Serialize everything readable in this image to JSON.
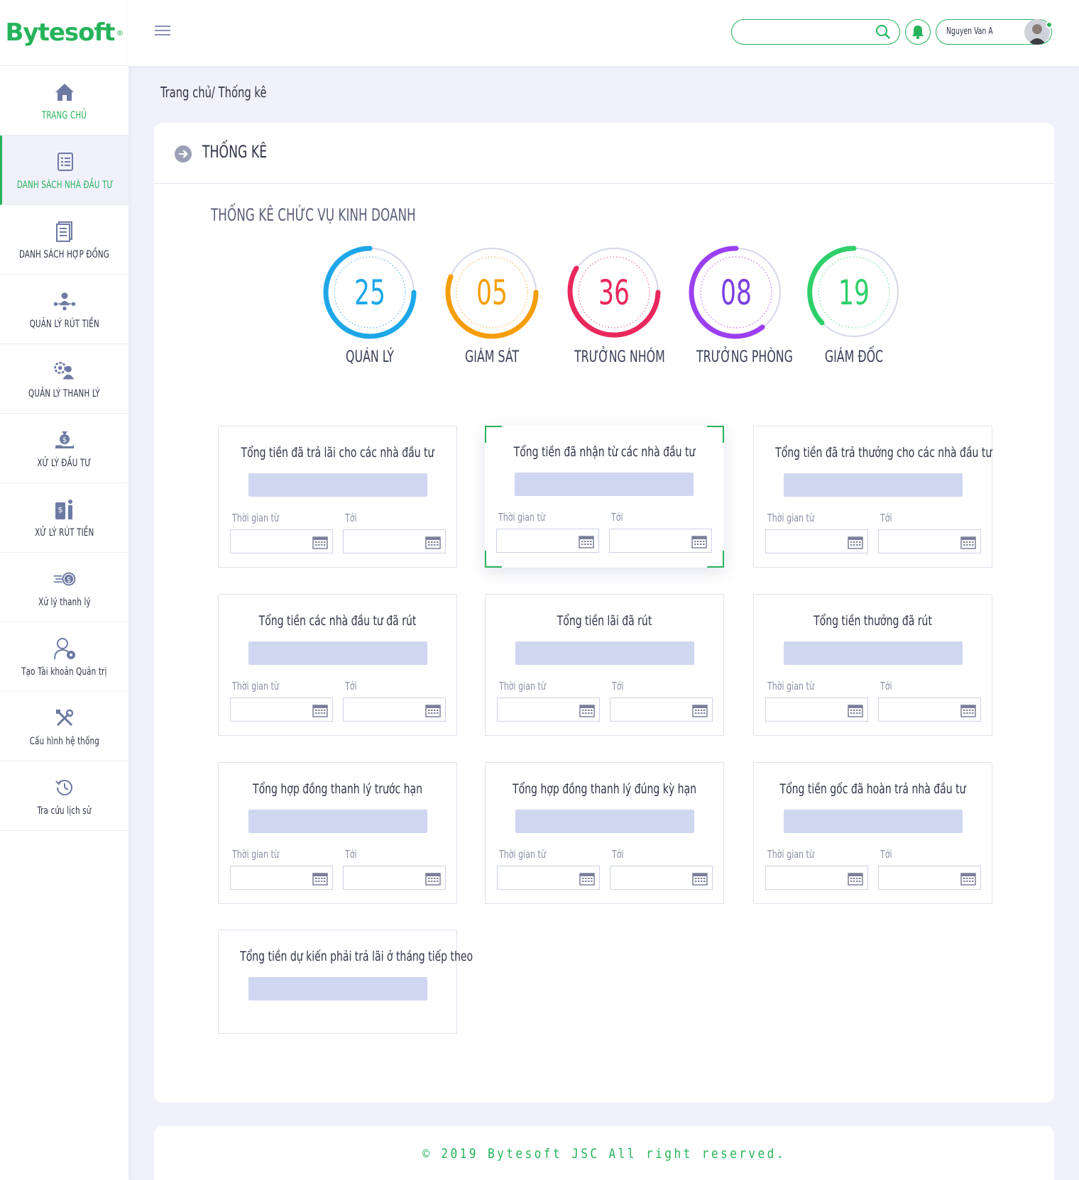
{
  "brand": {
    "name": "Bytesoft",
    "registered": "®"
  },
  "sidebar": {
    "items": [
      {
        "label": "TRANG CHỦ",
        "icon": "home-icon"
      },
      {
        "label": "DANH SÁCH NHÀ ĐẦU TƯ",
        "icon": "list-icon"
      },
      {
        "label": "DANH SÁCH HỢP ĐỒNG",
        "icon": "contract-icon"
      },
      {
        "label": "QUẢN LÝ RÚT TIỀN",
        "icon": "network-user-icon"
      },
      {
        "label": "QUẢN LÝ THANH LÝ",
        "icon": "user-gear-icon"
      },
      {
        "label": "XỬ LÝ ĐẦU TƯ",
        "icon": "money-bag-hand-icon"
      },
      {
        "label": "XỬ LÝ RÚT TIỀN",
        "icon": "withdraw-icon"
      },
      {
        "label": "Xử lý thanh lý",
        "icon": "fast-coin-icon"
      },
      {
        "label": "Tạo Tài khoản Quản trị",
        "icon": "admin-user-icon"
      },
      {
        "label": "Cấu hình hệ thống",
        "icon": "tools-icon"
      },
      {
        "label": "Tra cứu lịch sử",
        "icon": "history-icon"
      }
    ]
  },
  "header": {
    "search_placeholder": "",
    "user_name": "Nguyen Van A"
  },
  "breadcrumb": "Trang chủ/ Thống kê",
  "page": {
    "title": "THỐNG KÊ",
    "section_title": "THỐNG KÊ CHỨC VỤ KINH DOANH"
  },
  "positions": [
    {
      "value": "25",
      "label": "QUẢN LÝ",
      "color": "#1ea7e8"
    },
    {
      "value": "05",
      "label": "GIÁM SÁT",
      "color": "#f59e0b"
    },
    {
      "value": "36",
      "label": "TRƯỞNG NHÓM",
      "color": "#e8285c"
    },
    {
      "value": "08",
      "label": "TRƯỞNG PHÒNG",
      "color": "#9b3ff0"
    },
    {
      "value": "19",
      "label": "GIÁM ĐỐC",
      "color": "#2fd06a"
    }
  ],
  "stats": {
    "from_label": "Thời gian từ",
    "to_label": "Tới",
    "cards": [
      {
        "title": "Tổng tiền đã trả lãi cho các nhà đầu tư",
        "value": ""
      },
      {
        "title": "Tổng tiền đã nhận từ các nhà đầu tư",
        "value": ""
      },
      {
        "title": "Tổng tiền đã trả thưởng cho các nhà đầu tư",
        "value": ""
      },
      {
        "title": "Tổng tiền các nhà đầu tư đã rút",
        "value": ""
      },
      {
        "title": "Tổng tiền lãi đã rút",
        "value": ""
      },
      {
        "title": "Tổng tiền thưởng đã rút",
        "value": ""
      },
      {
        "title": "Tổng hợp đồng thanh lý trước hạn",
        "value": ""
      },
      {
        "title": "Tổng hợp đồng thanh lý đúng kỳ hạn",
        "value": ""
      },
      {
        "title": "Tổng tiền gốc đã hoàn trả nhà đầu tư",
        "value": ""
      },
      {
        "title": "Tổng tiền dự kiến phải trả lãi ở tháng tiếp theo",
        "value": ""
      }
    ]
  },
  "footer": {
    "text": "© 2019 Bytesoft JSC All right reserved."
  },
  "colors": {
    "accent": "#27b35b",
    "value_bar": "#cfd6f0",
    "background": "#f1f1fb"
  }
}
